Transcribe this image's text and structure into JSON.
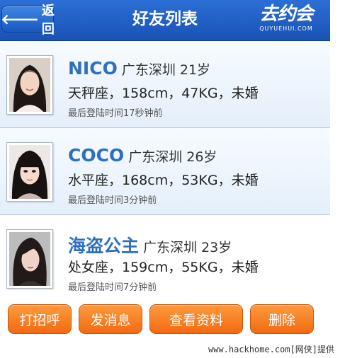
{
  "header": {
    "back_label": "返回",
    "title": "好友列表",
    "logo_text": "去约会",
    "logo_sub": "QUYUEHUI.COM"
  },
  "friends": [
    {
      "name": "NICO",
      "location_age": "广东深圳 21岁",
      "details": "天秤座，158cm，47KG，未婚",
      "last_login": "最后登陆时间17秒钟前"
    },
    {
      "name": "COCO",
      "location_age": "广东深圳 26岁",
      "details": "水平座，168cm，53KG，未婚",
      "last_login": "最后登陆时间3分钟前"
    },
    {
      "name": "海盗公主",
      "location_age": "广东深圳 23岁",
      "details": "处女座，159cm，55KG，未婚",
      "last_login": "最后登陆时间7分钟前"
    }
  ],
  "actions": {
    "greet": "打招呼",
    "message": "发消息",
    "profile": "查看资料",
    "delete": "删除"
  },
  "watermark": "www.hackhome.com[网侠]提供",
  "colors": {
    "header_blue": "#1f5fc6",
    "name_blue": "#2f6fc0",
    "button_orange": "#f47a1f"
  }
}
